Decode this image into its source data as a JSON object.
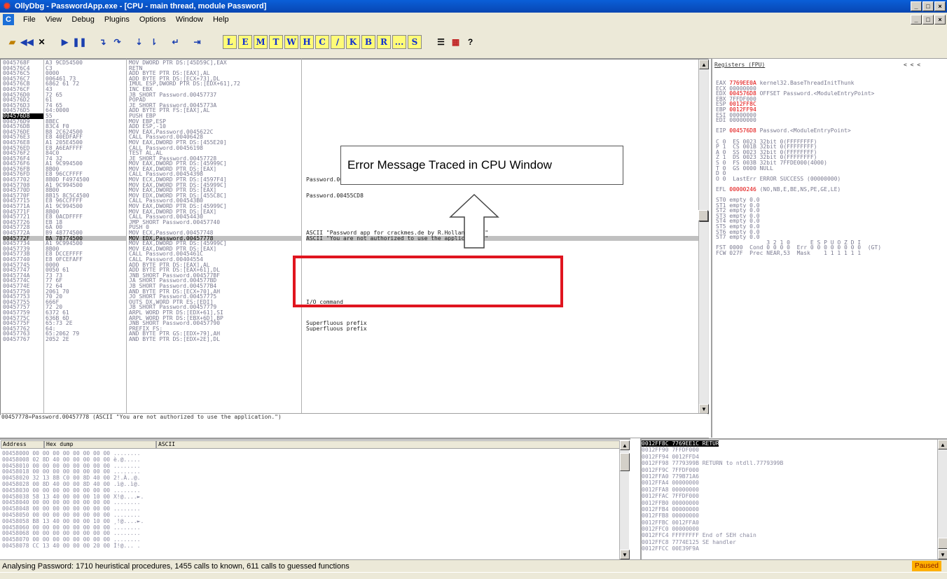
{
  "window": {
    "title": "OllyDbg - PasswordApp.exe - [CPU - main thread, module Password]"
  },
  "menu": {
    "items": [
      "File",
      "View",
      "Debug",
      "Plugins",
      "Options",
      "Window",
      "Help"
    ]
  },
  "toolbar": {
    "letters": [
      "L",
      "E",
      "M",
      "T",
      "W",
      "H",
      "C",
      "/",
      "K",
      "B",
      "R",
      "...",
      "S"
    ]
  },
  "disasm": {
    "rows": [
      {
        "addr": "0045768F",
        "hex": "A3 9CD54500",
        "ins": "MOV DWORD PTR DS:[45D59C],EAX",
        "cmt": ""
      },
      {
        "addr": "004576C4",
        "hex": "C3",
        "ins": "RETN",
        "cmt": ""
      },
      {
        "addr": "004576C5",
        "hex": "0000",
        "ins": "ADD BYTE PTR DS:[EAX],AL",
        "cmt": ""
      },
      {
        "addr": "004576C7",
        "hex": "006461 73",
        "ins": "ADD BYTE PTR DS:[ECX+73],DL",
        "cmt": ""
      },
      {
        "addr": "004576CB",
        "hex": "6862 61 72",
        "ins": "IMUL ESP,DWORD PTR DS:[EDX+61],72",
        "cmt": ""
      },
      {
        "addr": "004576CF",
        "hex": "43",
        "ins": "INC EBX",
        "cmt": ""
      },
      {
        "addr": "004576D0",
        "hex": "72 65",
        "ins": "JB SHORT Password.00457737",
        "cmt": ""
      },
      {
        "addr": "004576D2",
        "hex": "61",
        "ins": "POPAD",
        "cmt": ""
      },
      {
        "addr": "004576D3",
        "hex": "74 65",
        "ins": "JE SHORT Password.0045773A",
        "cmt": ""
      },
      {
        "addr": "004576D5",
        "hex": "64:0000",
        "ins": "ADD BYTE PTR FS:[EAX],AL",
        "cmt": ""
      },
      {
        "addr": "004576D8",
        "hex": "55",
        "ins": "PUSH EBP",
        "cmt": ""
      },
      {
        "addr": "004576D9",
        "hex": "8BEC",
        "ins": "MOV EBP,ESP",
        "cmt": ""
      },
      {
        "addr": "004576DB",
        "hex": "83C4 F0",
        "ins": "ADD ESP,-10",
        "cmt": ""
      },
      {
        "addr": "004576DE",
        "hex": "B8 2C624500",
        "ins": "MOV EAX,Password.0045622C",
        "cmt": ""
      },
      {
        "addr": "004576E3",
        "hex": "E8 40EDFAFF",
        "ins": "CALL Password.00406428",
        "cmt": ""
      },
      {
        "addr": "004576E8",
        "hex": "A1 205E4500",
        "ins": "MOV EAX,DWORD PTR DS:[455E20]",
        "cmt": ""
      },
      {
        "addr": "004576ED",
        "hex": "E8 A6EAFFFF",
        "ins": "CALL Password.00456198",
        "cmt": ""
      },
      {
        "addr": "004576F2",
        "hex": "84C0",
        "ins": "TEST AL,AL",
        "cmt": ""
      },
      {
        "addr": "004576F4",
        "hex": "74 32",
        "ins": "JE SHORT Password.00457728",
        "cmt": ""
      },
      {
        "addr": "004576F6",
        "hex": "A1 9C994500",
        "ins": "MOV EAX,DWORD PTR DS:[45999C]",
        "cmt": ""
      },
      {
        "addr": "004576FB",
        "hex": "8B00",
        "ins": "MOV EAX,DWORD PTR DS:[EAX]",
        "cmt": ""
      },
      {
        "addr": "004576FD",
        "hex": "E8 96CCFFFF",
        "ins": "CALL Password.00454398",
        "cmt": ""
      },
      {
        "addr": "00457702",
        "hex": "8B0D F4974500",
        "ins": "MOV ECX,DWORD PTR DS:[4597F4]",
        "cmt": "Password.0045D5A0"
      },
      {
        "addr": "00457708",
        "hex": "A1 9C994500",
        "ins": "MOV EAX,DWORD PTR DS:[45999C]",
        "cmt": ""
      },
      {
        "addr": "0045770D",
        "hex": "8B00",
        "ins": "MOV EAX,DWORD PTR DS:[EAX]",
        "cmt": ""
      },
      {
        "addr": "0045770F",
        "hex": "8B15 8C5C4500",
        "ins": "MOV EDX,DWORD PTR DS:[455C8C]",
        "cmt": "Password.00455CD8"
      },
      {
        "addr": "00457715",
        "hex": "E8 96CCFFFF",
        "ins": "CALL Password.004543B0",
        "cmt": ""
      },
      {
        "addr": "0045771A",
        "hex": "A1 9C994500",
        "ins": "MOV EAX,DWORD PTR DS:[45999C]",
        "cmt": ""
      },
      {
        "addr": "0045771F",
        "hex": "8B00",
        "ins": "MOV EAX,DWORD PTR DS:[EAX]",
        "cmt": ""
      },
      {
        "addr": "00457721",
        "hex": "E8 0ACDFFFF",
        "ins": "CALL Password.00454430",
        "cmt": ""
      },
      {
        "addr": "00457726",
        "hex": "EB 18",
        "ins": "JMP SHORT Password.00457740",
        "cmt": ""
      },
      {
        "addr": "00457728",
        "hex": "6A 00",
        "ins": "PUSH 0",
        "cmt": ""
      },
      {
        "addr": "0045772A",
        "hex": "B9 48774500",
        "ins": "MOV ECX,Password.00457748",
        "cmt": "ASCII \"Password app for crackmes.de by R.Holland 2007\""
      },
      {
        "addr": "0045772F",
        "hex": "BA 78774500",
        "ins": "MOV EDX,Password.00457778",
        "cmt": "ASCII \"You are not authorized to use the application.\""
      },
      {
        "addr": "00457734",
        "hex": "A1 9C994500",
        "ins": "MOV EAX,DWORD PTR DS:[45999C]",
        "cmt": ""
      },
      {
        "addr": "00457739",
        "hex": "8B00",
        "ins": "MOV EAX,DWORD PTR DS:[EAX]",
        "cmt": ""
      },
      {
        "addr": "0045773B",
        "hex": "E8 DCCEFFFF",
        "ins": "CALL Password.0045461C",
        "cmt": ""
      },
      {
        "addr": "00457740",
        "hex": "E8 0FCEFAFF",
        "ins": "CALL Password.00404554",
        "cmt": ""
      },
      {
        "addr": "00457745",
        "hex": "0000",
        "ins": "ADD BYTE PTR DS:[EAX],AL",
        "cmt": ""
      },
      {
        "addr": "00457747",
        "hex": "0050 61",
        "ins": "ADD BYTE PTR DS:[EAX+61],DL",
        "cmt": ""
      },
      {
        "addr": "0045774A",
        "hex": "73 73",
        "ins": "JNB SHORT Password.004577BF",
        "cmt": ""
      },
      {
        "addr": "0045774C",
        "hex": "77 6F",
        "ins": "JA SHORT Password.004577BD",
        "cmt": ""
      },
      {
        "addr": "0045774E",
        "hex": "72 64",
        "ins": "JB SHORT Password.004577B4",
        "cmt": ""
      },
      {
        "addr": "00457750",
        "hex": "2061 70",
        "ins": "AND BYTE PTR DS:[ECX+70],AH",
        "cmt": ""
      },
      {
        "addr": "00457753",
        "hex": "70 20",
        "ins": "JO SHORT Password.00457775",
        "cmt": ""
      },
      {
        "addr": "00457755",
        "hex": "666F",
        "ins": "OUTS DX,WORD PTR ES:[EDI]",
        "cmt": "I/O command"
      },
      {
        "addr": "00457757",
        "hex": "72 20",
        "ins": "JB SHORT Password.00457779",
        "cmt": ""
      },
      {
        "addr": "00457759",
        "hex": "6372 61",
        "ins": "ARPL WORD PTR DS:[EDX+61],SI",
        "cmt": ""
      },
      {
        "addr": "0045775C",
        "hex": "636B 6D",
        "ins": "ARPL WORD PTR DS:[EBX+6D],BP",
        "cmt": ""
      },
      {
        "addr": "0045775F",
        "hex": "65:73 2E",
        "ins": "JNB SHORT Password.00457790",
        "cmt": "Superfluous prefix"
      },
      {
        "addr": "00457762",
        "hex": "64:",
        "ins": "PREFIX FS:",
        "cmt": "Superfluous prefix"
      },
      {
        "addr": "00457763",
        "hex": "65:2062 79",
        "ins": "AND BYTE PTR GS:[EDX+79],AH",
        "cmt": ""
      },
      {
        "addr": "00457767",
        "hex": "2052 2E",
        "ins": "AND BYTE PTR DS:[EDX+2E],DL",
        "cmt": ""
      }
    ],
    "info_line": "00457778=Password.00457778 (ASCII \"You are not authorized to use the application.\")"
  },
  "annotation": {
    "text": "Error Message Traced in CPU Window"
  },
  "registers": {
    "title": "Registers (FPU)",
    "lines": [
      {
        "t": "EAX 7769EE0A kernel32.BaseThreadInitThunk",
        "red": "7769EE0A"
      },
      {
        "t": "ECX 00000000",
        "red": ""
      },
      {
        "t": "EDX 004576D8 OFFSET Password.<ModuleEntryPoint>",
        "red": "004576D8"
      },
      {
        "t": "EBX 7FFDF000",
        "red": ""
      },
      {
        "t": "ESP 0012FF8C",
        "red": "0012FF8C"
      },
      {
        "t": "EBP 0012FF94",
        "red": "0012FF94"
      },
      {
        "t": "ESI 00000000",
        "red": ""
      },
      {
        "t": "EDI 00000000",
        "red": ""
      },
      {
        "t": "",
        "red": ""
      },
      {
        "t": "EIP 004576D8 Password.<ModuleEntryPoint>",
        "red": "004576D8"
      },
      {
        "t": "",
        "red": ""
      },
      {
        "t": "C 0  ES 0023 32bit 0(FFFFFFFF)",
        "red": ""
      },
      {
        "t": "P 1  CS 001B 32bit 0(FFFFFFFF)",
        "red": ""
      },
      {
        "t": "A 0  SS 0023 32bit 0(FFFFFFFF)",
        "red": ""
      },
      {
        "t": "Z 1  DS 0023 32bit 0(FFFFFFFF)",
        "red": ""
      },
      {
        "t": "S 0  FS 003B 32bit 7FFDE000(4000)",
        "red": ""
      },
      {
        "t": "T 0  GS 0000 NULL",
        "red": ""
      },
      {
        "t": "D 0",
        "red": ""
      },
      {
        "t": "O 0  LastErr ERROR_SUCCESS (00000000)",
        "red": ""
      },
      {
        "t": "",
        "red": ""
      },
      {
        "t": "EFL 00000246 (NO,NB,E,BE,NS,PE,GE,LE)",
        "red": "00000246"
      },
      {
        "t": "",
        "red": ""
      },
      {
        "t": "ST0 empty 0.0",
        "red": ""
      },
      {
        "t": "ST1 empty 0.0",
        "red": ""
      },
      {
        "t": "ST2 empty 0.0",
        "red": ""
      },
      {
        "t": "ST3 empty 0.0",
        "red": ""
      },
      {
        "t": "ST4 empty 0.0",
        "red": ""
      },
      {
        "t": "ST5 empty 0.0",
        "red": ""
      },
      {
        "t": "ST6 empty 0.0",
        "red": ""
      },
      {
        "t": "ST7 empty 0.0",
        "red": ""
      },
      {
        "t": "               3 2 1 0      E S P U O Z D I",
        "red": ""
      },
      {
        "t": "FST 0000  Cond 0 0 0 0  Err 0 0 0 0 0 0 0 0  (GT)",
        "red": ""
      },
      {
        "t": "FCW 027F  Prec NEAR,53  Mask    1 1 1 1 1 1",
        "red": ""
      }
    ]
  },
  "dump": {
    "headers": [
      "Address",
      "Hex dump",
      "ASCII"
    ],
    "rows": [
      [
        "00458000",
        "00 00 00 00 00 00 00 00",
        "........"
      ],
      [
        "00458008",
        "02 8D 40 00 00 00 00 00",
        "è.@....."
      ],
      [
        "00458010",
        "00 00 00 00 00 00 00 00",
        "........"
      ],
      [
        "00458018",
        "00 00 00 00 00 00 00 00",
        "........"
      ],
      [
        "00458020",
        "32 13 8B C0 00 8D 40 00",
        "2!.À..@."
      ],
      [
        "00458028",
        "00 8D 40 00 00 8D 40 00",
        ".ì@..ì@."
      ],
      [
        "00458030",
        "00 00 00 00 00 00 00 00",
        "........"
      ],
      [
        "00458038",
        "58 13 40 00 00 00 10 00",
        "X!@....►."
      ],
      [
        "00458040",
        "00 00 00 00 00 00 00 00",
        "........"
      ],
      [
        "00458048",
        "00 00 00 00 00 00 00 00",
        "........"
      ],
      [
        "00458050",
        "00 00 00 00 00 00 00 00",
        "........"
      ],
      [
        "00458058",
        "B8 13 40 00 00 00 10 00",
        "¸!@....►."
      ],
      [
        "00458060",
        "00 00 00 00 00 00 00 00",
        "........"
      ],
      [
        "00458068",
        "00 00 00 00 00 00 00 00",
        "........"
      ],
      [
        "00458070",
        "00 00 00 00 00 00 00 00",
        "........"
      ],
      [
        "00458078",
        "CC 13 40 00 00 00 20 00",
        "Ì!@... ."
      ]
    ]
  },
  "stack": {
    "rows": [
      [
        "0012FF8C",
        "7769EE1C",
        "RETURN to kernel32.7769EE1C"
      ],
      [
        "0012FF90",
        "7FFDF000",
        ""
      ],
      [
        "0012FF94",
        "0012FFD4",
        ""
      ],
      [
        "0012FF98",
        "7779399B",
        "RETURN to ntdll.7779399B"
      ],
      [
        "0012FF9C",
        "7FFDF000",
        ""
      ],
      [
        "0012FFA0",
        "779B71A6",
        ""
      ],
      [
        "0012FFA4",
        "00000000",
        ""
      ],
      [
        "0012FFA8",
        "00000000",
        ""
      ],
      [
        "0012FFAC",
        "7FFDF000",
        ""
      ],
      [
        "0012FFB0",
        "00000000",
        ""
      ],
      [
        "0012FFB4",
        "00000000",
        ""
      ],
      [
        "0012FFB8",
        "00000000",
        ""
      ],
      [
        "0012FFBC",
        "0012FFA0",
        ""
      ],
      [
        "0012FFC0",
        "00000000",
        ""
      ],
      [
        "0012FFC4",
        "FFFFFFFF",
        "End of SEH chain"
      ],
      [
        "0012FFC8",
        "7774E125",
        "SE handler"
      ],
      [
        "0012FFCC",
        "00E39F9A",
        ""
      ]
    ]
  },
  "status": {
    "text": "Analysing Password: 1710 heuristical procedures, 1455 calls to known, 611 calls to guessed functions",
    "state": "Paused"
  }
}
